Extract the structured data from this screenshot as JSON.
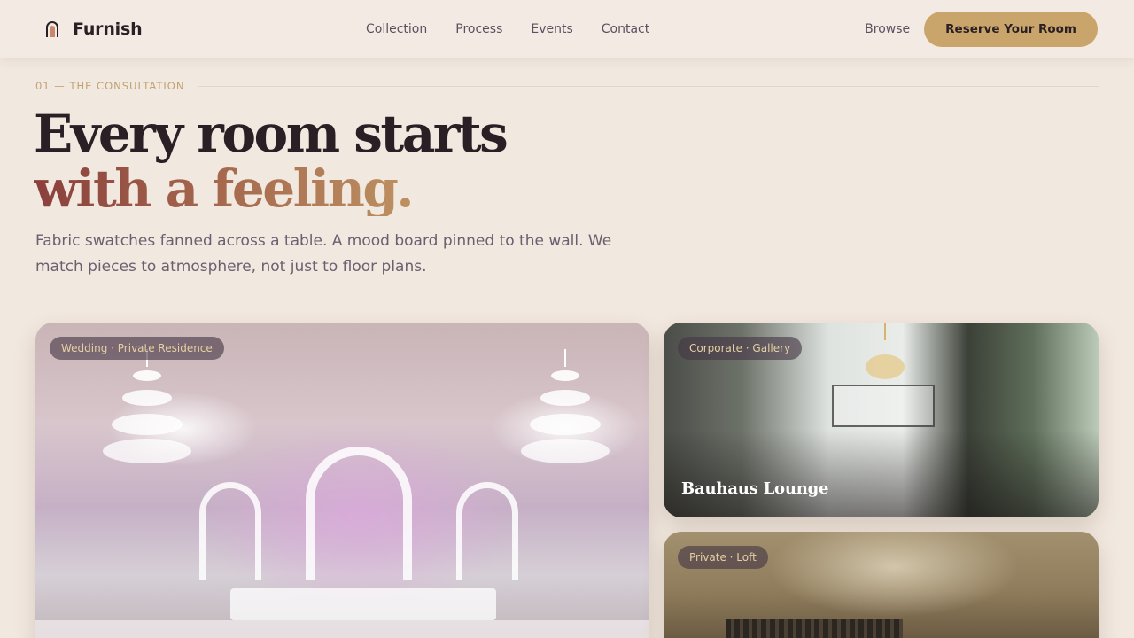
{
  "brand": {
    "name": "Furnish",
    "icon": "arch-logo-icon"
  },
  "nav": {
    "links": [
      "Collection",
      "Process",
      "Events",
      "Contact"
    ],
    "browse_label": "Browse",
    "cta_label": "Reserve Your Room"
  },
  "hero": {
    "eyebrow": "01 — THE CONSULTATION",
    "headline_line1": "Every room starts",
    "headline_line2": "with a feeling.",
    "lead": "Fabric swatches fanned across a table. A mood board pinned to the wall. We match pieces to atmosphere, not just to floor plans."
  },
  "cards": [
    {
      "tag": "Wedding · Private Residence",
      "title": ""
    },
    {
      "tag": "Corporate · Gallery",
      "title": "Bauhaus Lounge"
    },
    {
      "tag": "Private · Loft",
      "title": ""
    }
  ],
  "colors": {
    "background": "#f1e8df",
    "accent_gold": "#c9a56b",
    "headline_dark": "#2a1f24",
    "headline_gradient_start": "#8a3f3c",
    "headline_gradient_end": "#c9a56b",
    "tag_text": "#e6cfa3"
  }
}
